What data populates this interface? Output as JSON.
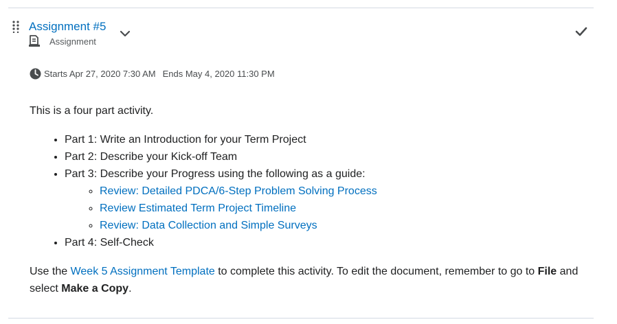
{
  "item": {
    "title": "Assignment #5",
    "type_label": "Assignment",
    "starts": "Starts Apr 27, 2020 7:30 AM",
    "ends": "Ends May 4, 2020 11:30 PM"
  },
  "icons": {
    "drag": "drag-handle-icon",
    "chevron": "chevron-down-icon",
    "type": "assignment-icon",
    "check": "checkmark-icon",
    "clock": "clock-icon"
  },
  "colors": {
    "link": "#006fbf",
    "text": "#202122",
    "muted": "#494c4e",
    "divider": "#d3d9e3"
  },
  "body": {
    "intro": "This is a four part activity.",
    "parts": [
      "Part 1: Write an Introduction for your Term Project",
      "Part 2: Describe your Kick-off Team",
      "Part 3: Describe your Progress using the following as a guide:",
      "Part 4: Self-Check"
    ],
    "guide_links": [
      "Review: Detailed PDCA/6-Step Problem Solving Process",
      "Review Estimated Term Project Timeline",
      "Review: Data Collection and Simple Surveys"
    ],
    "outro": {
      "before": "Use the ",
      "link": "Week 5 Assignment Template",
      "after": " to complete this activity. To edit the document, remember to go to ",
      "file": "File",
      "middle": " and select ",
      "make_copy": "Make a Copy",
      "end": "."
    }
  }
}
